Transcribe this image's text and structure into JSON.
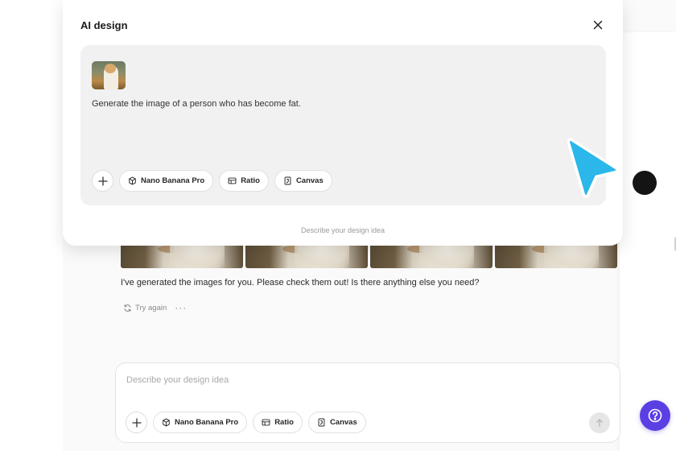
{
  "modal": {
    "title": "AI design",
    "prompt_text": "Generate the image of a person who has become fat.",
    "footer_hint": "Describe your design idea",
    "chips": {
      "model": "Nano Banana Pro",
      "ratio": "Ratio",
      "canvas": "Canvas"
    }
  },
  "conversation": {
    "assistant_message": "I've generated the images for you. Please check them out! Is there anything else you need?",
    "try_again": "Try again",
    "more": "···"
  },
  "composer": {
    "placeholder": "Describe your design idea",
    "chips": {
      "model": "Nano Banana Pro",
      "ratio": "Ratio",
      "canvas": "Canvas"
    }
  },
  "icons": {
    "close": "close-icon",
    "plus": "plus-icon",
    "model": "cube-icon",
    "ratio": "ratio-icon",
    "canvas": "canvas-icon",
    "send": "arrow-up-icon",
    "help": "help-icon",
    "retry": "refresh-icon",
    "cursor": "pointer-cursor-icon"
  },
  "colors": {
    "accent": "#5b3fe3",
    "cursor": "#2bb7ea",
    "send_active": "#141414"
  }
}
